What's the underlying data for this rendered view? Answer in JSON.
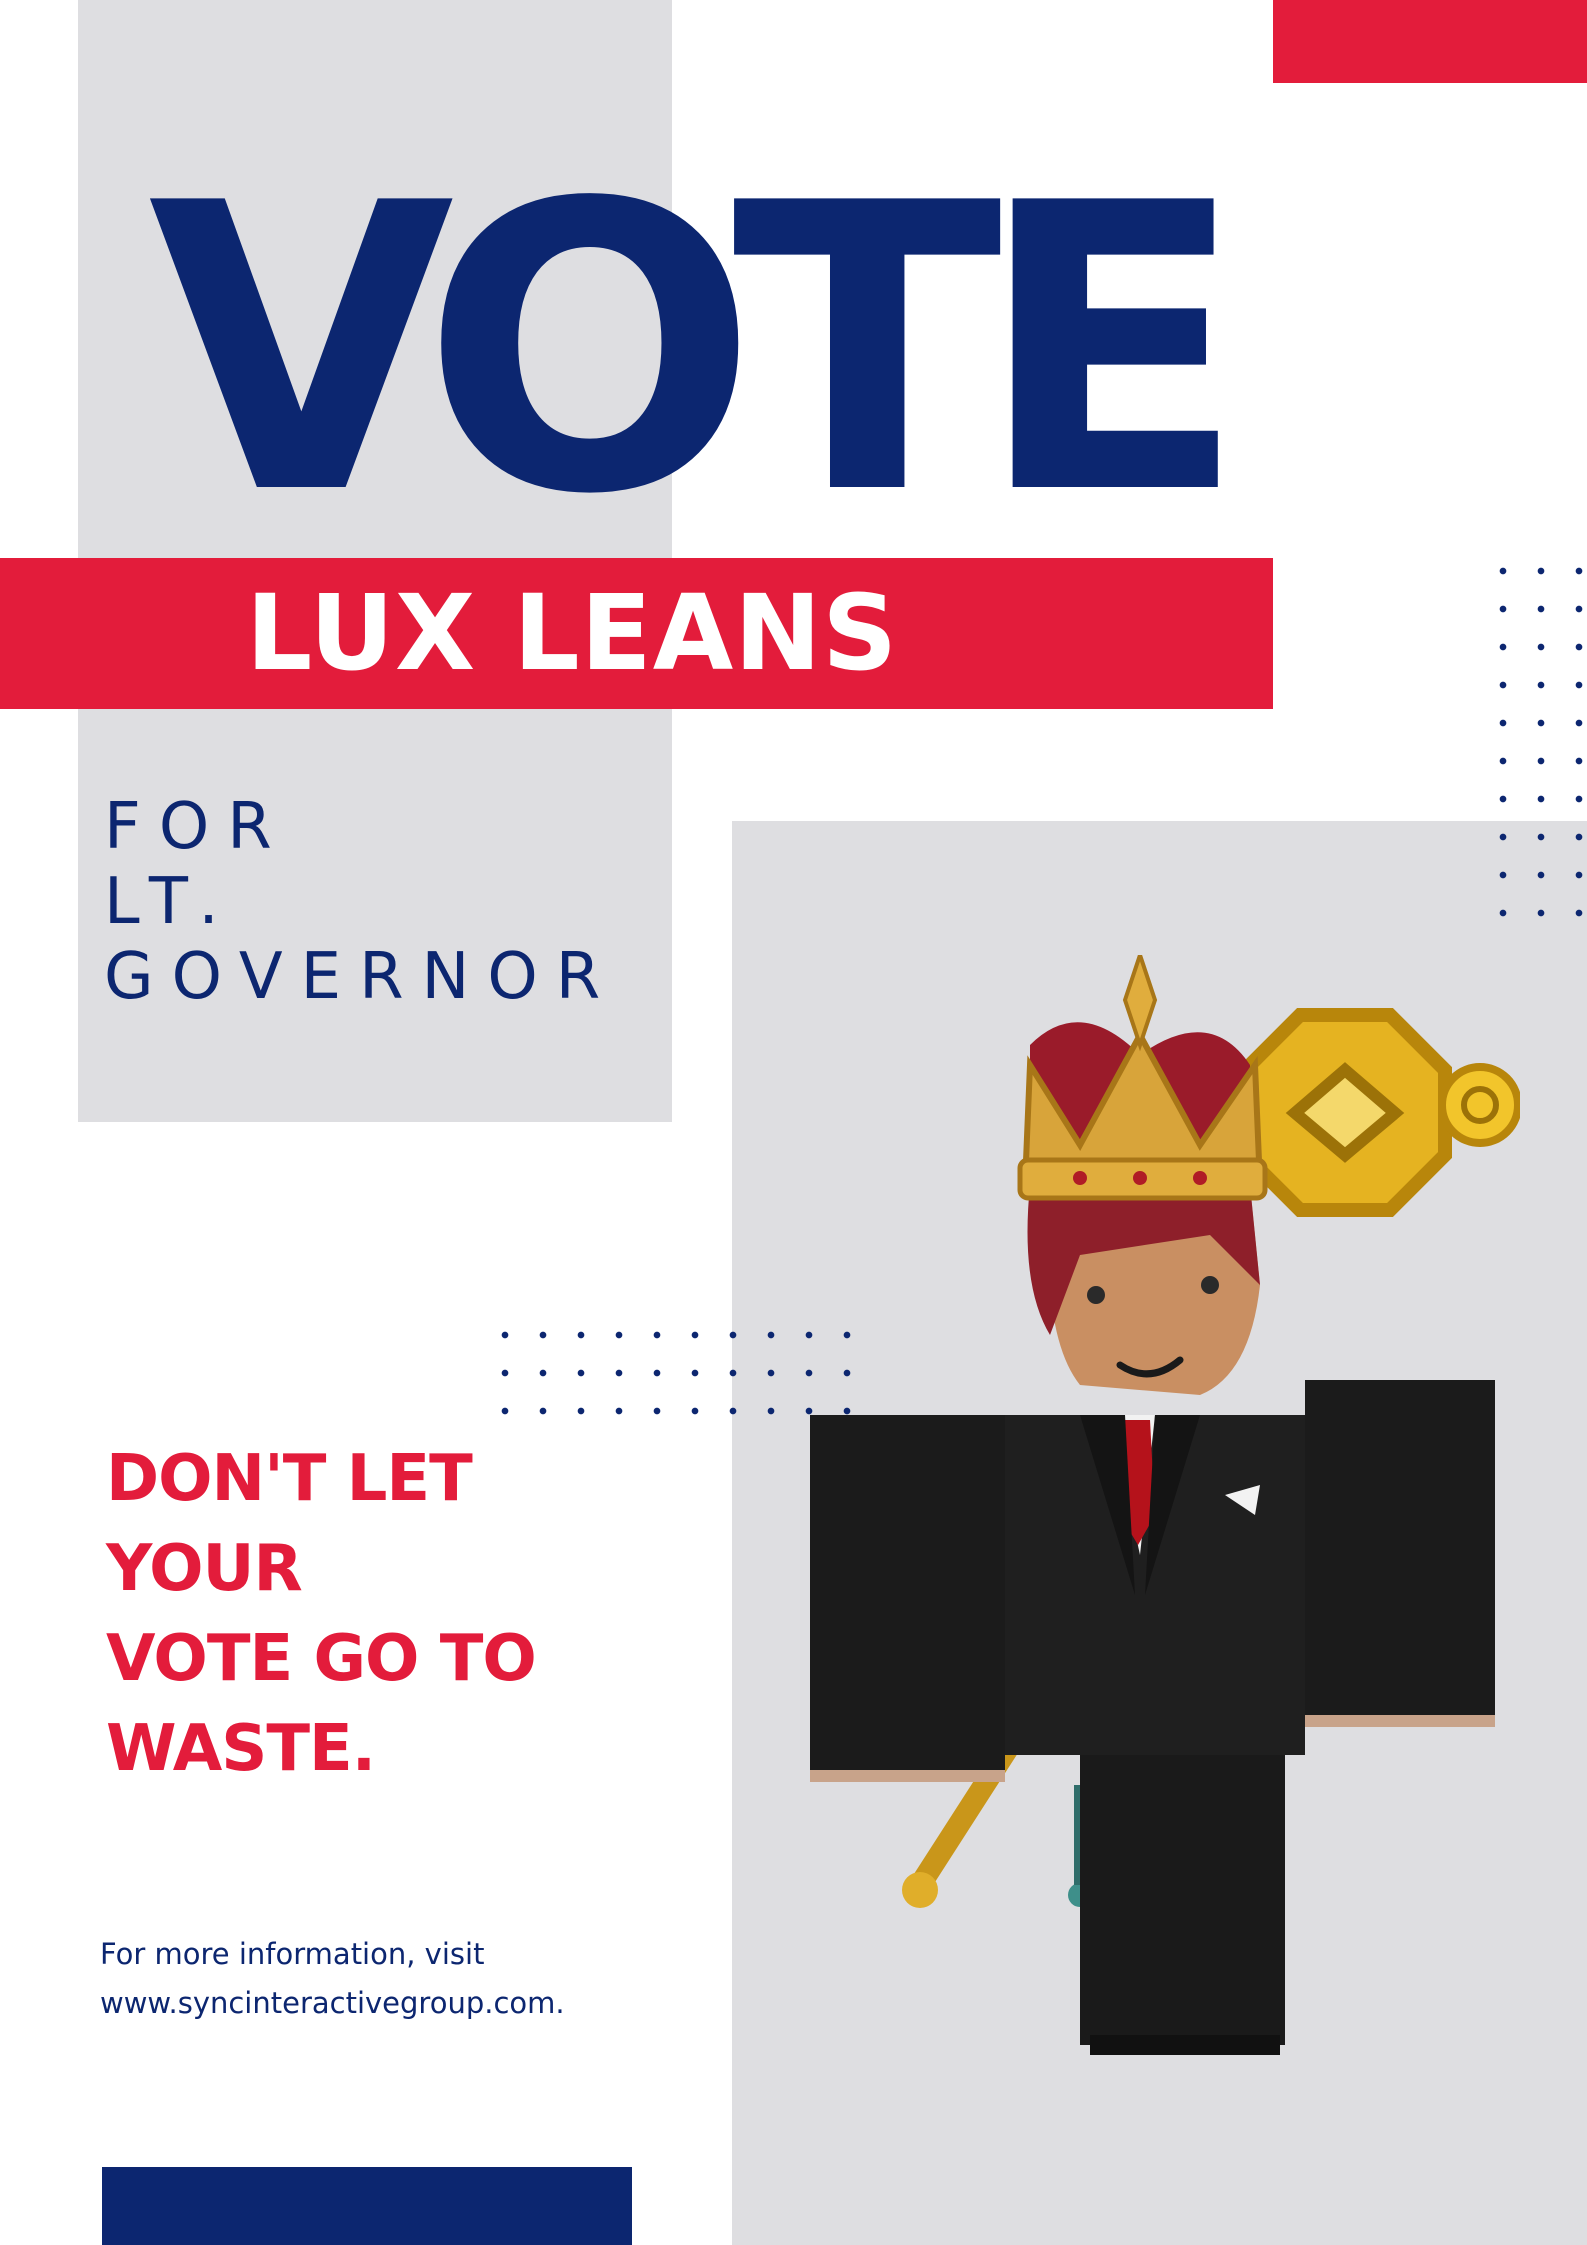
{
  "headline": "VOTE",
  "candidate": "LUX LEANS",
  "office_lines": [
    "FOR",
    "LT.",
    "GOVERNOR"
  ],
  "slogan_lines": [
    "DON'T LET",
    "YOUR",
    "VOTE GO TO",
    "WASTE."
  ],
  "info_lines": [
    "For more information, visit",
    "www.syncinteractivegroup.com."
  ],
  "colors": {
    "navy": "#0c2670",
    "red": "#e31c3b",
    "gray_panel": "#dedee1",
    "background": "#ffffff"
  },
  "image": "avatar-figure"
}
